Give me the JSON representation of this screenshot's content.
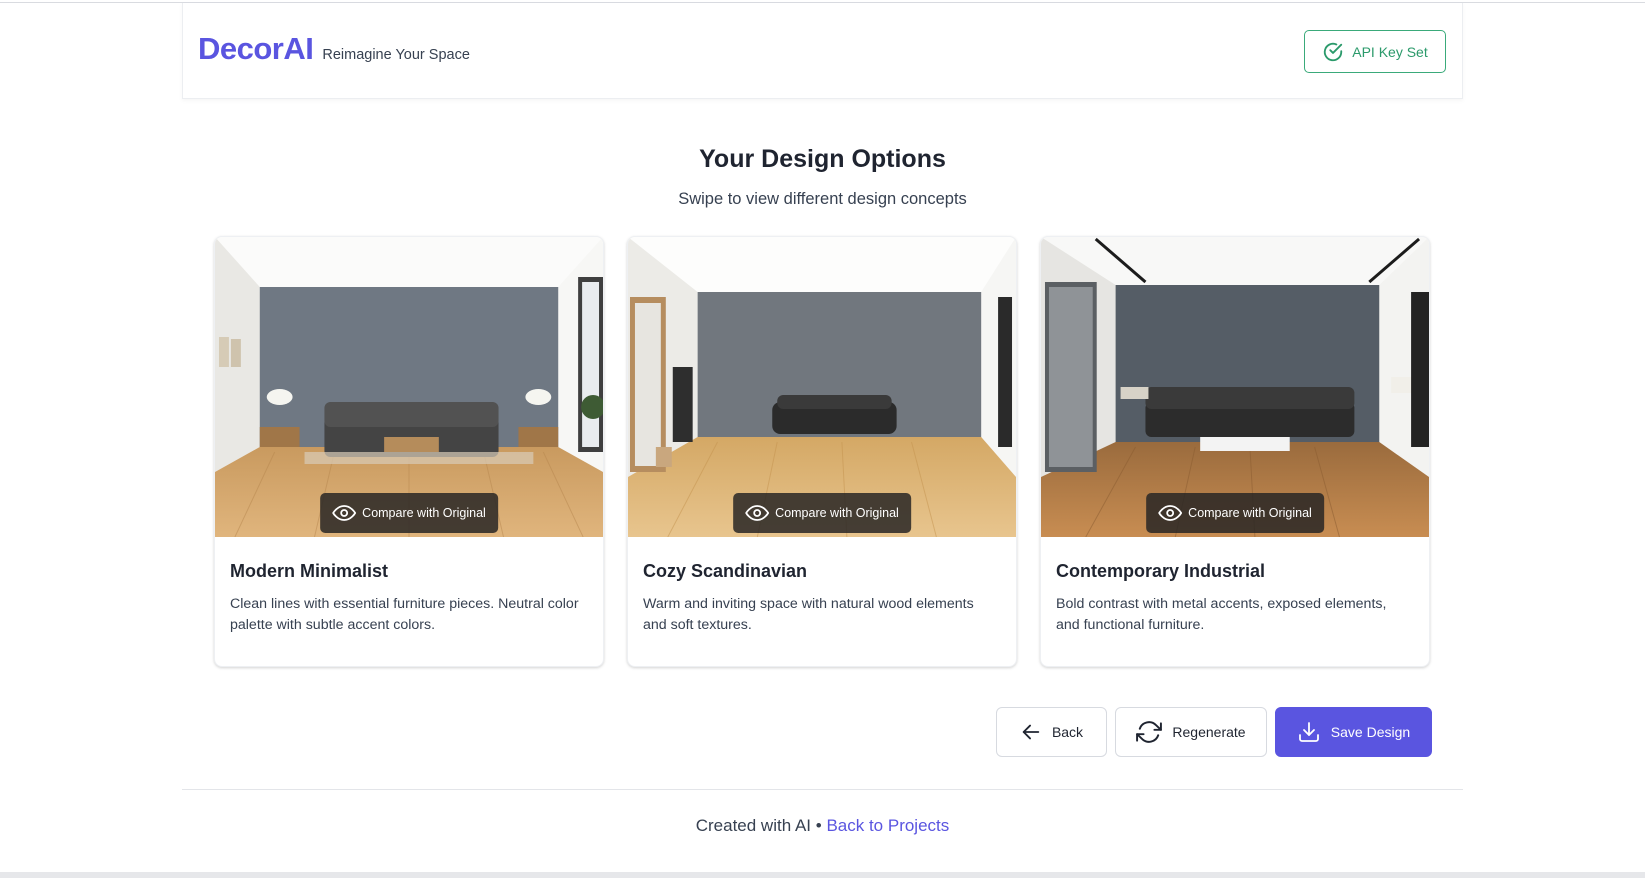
{
  "header": {
    "logo": "DecorAI",
    "tagline": "Reimagine Your Space",
    "api_status": "API Key Set"
  },
  "main": {
    "title": "Your Design Options",
    "subtitle": "Swipe to view different design concepts",
    "cards": [
      {
        "title": "Modern Minimalist",
        "description": "Clean lines with essential furniture pieces. Neutral color palette with subtle accent colors.",
        "compare_label": "Compare with Original"
      },
      {
        "title": "Cozy Scandinavian",
        "description": "Warm and inviting space with natural wood elements and soft textures.",
        "compare_label": "Compare with Original"
      },
      {
        "title": "Contemporary Industrial",
        "description": "Bold contrast with metal accents, exposed elements, and functional furniture.",
        "compare_label": "Compare with Original"
      }
    ]
  },
  "actions": {
    "back": "Back",
    "regenerate": "Regenerate",
    "save": "Save Design"
  },
  "footer": {
    "text": "Created with AI •",
    "link": "Back to Projects"
  },
  "colors": {
    "brand": "#5a55e0",
    "success": "#2b9a6b"
  },
  "icons": {
    "api": "check-circle-icon",
    "compare": "eye-icon",
    "back": "arrow-left-icon",
    "regenerate": "refresh-icon",
    "save": "download-icon"
  }
}
